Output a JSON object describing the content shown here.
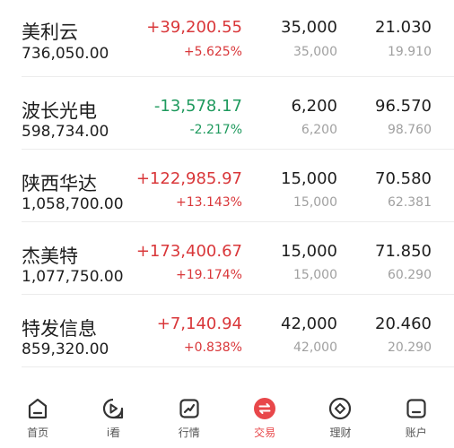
{
  "holdings": [
    {
      "name": "美利云",
      "market_value": "736,050.00",
      "pl": "+39,200.55",
      "pl_pct": "+5.625%",
      "qty": "35,000",
      "avail": "35,000",
      "price": "21.030",
      "cost": "19.910",
      "dir": "up"
    },
    {
      "name": "波长光电",
      "market_value": "598,734.00",
      "pl": "-13,578.17",
      "pl_pct": "-2.217%",
      "qty": "6,200",
      "avail": "6,200",
      "price": "96.570",
      "cost": "98.760",
      "dir": "down"
    },
    {
      "name": "陕西华达",
      "market_value": "1,058,700.00",
      "pl": "+122,985.97",
      "pl_pct": "+13.143%",
      "qty": "15,000",
      "avail": "15,000",
      "price": "70.580",
      "cost": "62.381",
      "dir": "up"
    },
    {
      "name": "杰美特",
      "market_value": "1,077,750.00",
      "pl": "+173,400.67",
      "pl_pct": "+19.174%",
      "qty": "15,000",
      "avail": "15,000",
      "price": "71.850",
      "cost": "60.290",
      "dir": "up"
    },
    {
      "name": "特发信息",
      "market_value": "859,320.00",
      "pl": "+7,140.94",
      "pl_pct": "+0.838%",
      "qty": "42,000",
      "avail": "42,000",
      "price": "20.460",
      "cost": "20.290",
      "dir": "up"
    }
  ],
  "nav": {
    "items": [
      {
        "label": "首页",
        "icon": "home-icon"
      },
      {
        "label": "i看",
        "icon": "play-icon"
      },
      {
        "label": "行情",
        "icon": "trend-icon"
      },
      {
        "label": "交易",
        "icon": "exchange-icon",
        "active": true
      },
      {
        "label": "理财",
        "icon": "diamond-icon"
      },
      {
        "label": "账户",
        "icon": "account-icon"
      }
    ]
  },
  "colors": {
    "up": "#d9373a",
    "down": "#1f9a5e",
    "active": "#e8474a"
  }
}
